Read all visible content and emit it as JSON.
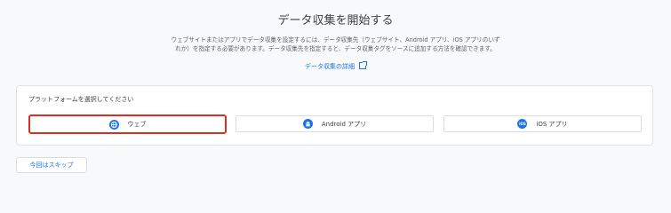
{
  "header": {
    "title": "データ収集を開始する",
    "description_line1": "ウェブサイトまたはアプリでデータ収集を設定するには、データ収集先（ウェブサイト、Android アプリ、iOS アプリのいず",
    "description_line2": "れか）を指定する必要があります。データ収集先を指定すると、データ収集タグをソースに追加する方法を確認できます。",
    "learn_more_label": "データ収集の詳細"
  },
  "platform_selector": {
    "label": "プラットフォームを選択してください",
    "options": [
      {
        "label": "ウェブ",
        "icon": "globe-icon",
        "selected": true
      },
      {
        "label": "Android アプリ",
        "icon": "android-icon",
        "selected": false
      },
      {
        "label": "iOS アプリ",
        "icon": "ios-icon",
        "selected": false
      }
    ],
    "ios_icon_text": "iOS"
  },
  "footer": {
    "skip_label": "今回はスキップ"
  },
  "colors": {
    "accent": "#1a73e8",
    "selected_outline": "#d93025",
    "background": "#f8f9fa"
  }
}
